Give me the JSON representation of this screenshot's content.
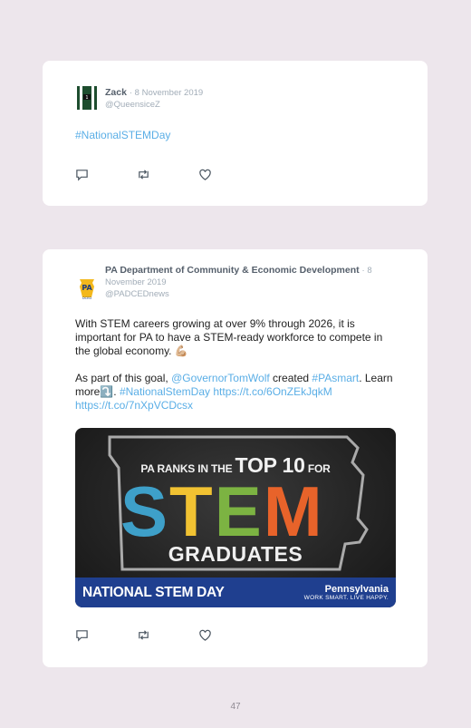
{
  "tweets": [
    {
      "author": "Zack",
      "date": "· 8 November 2019",
      "handle": "@QueensiceZ",
      "text": "#NationalSTEMDay"
    },
    {
      "author": "PA Department of Community & Economic Development",
      "date": "· 8 November 2019",
      "handle": "@PADCEDnews",
      "avatar_text": "PA",
      "avatar_subtext": "DCED",
      "para1": "With STEM careers growing at over 9% through 2026, it is important for PA to have a STEM-ready workforce to compete in the global economy. 💪🏼",
      "para2_prefix": "As part of this goal, ",
      "mention": "@GovernorTomWolf",
      "created": " created ",
      "hashtag1": "#PAsmart",
      "learn_more": ". Learn more⤵️. ",
      "hashtag2": "#NationalStemDay",
      "url1": "https://t.co/6OnZEkJqkM",
      "url2": "https://t.co/7nXpVCDcsx",
      "image": {
        "line1_small": "PA RANKS IN THE ",
        "line1_big": "TOP 10",
        "line1_end": " FOR",
        "stem_letters": [
          "S",
          "T",
          "E",
          "M"
        ],
        "stem_colors": [
          "#3ea0c9",
          "#f1c232",
          "#7cb342",
          "#e8632a"
        ],
        "graduates": "GRADUATES",
        "national": "NATIONAL STEM DAY",
        "brand": "Pennsylvania",
        "brand_tag": "WORK SMART. LIVE HAPPY."
      }
    }
  ],
  "icons": [
    "reply-icon",
    "retweet-icon",
    "like-icon"
  ],
  "page_number": "47",
  "colors": {
    "link": "#5aaee6",
    "banner": "#1f3f8f",
    "background": "#ede6ec"
  }
}
